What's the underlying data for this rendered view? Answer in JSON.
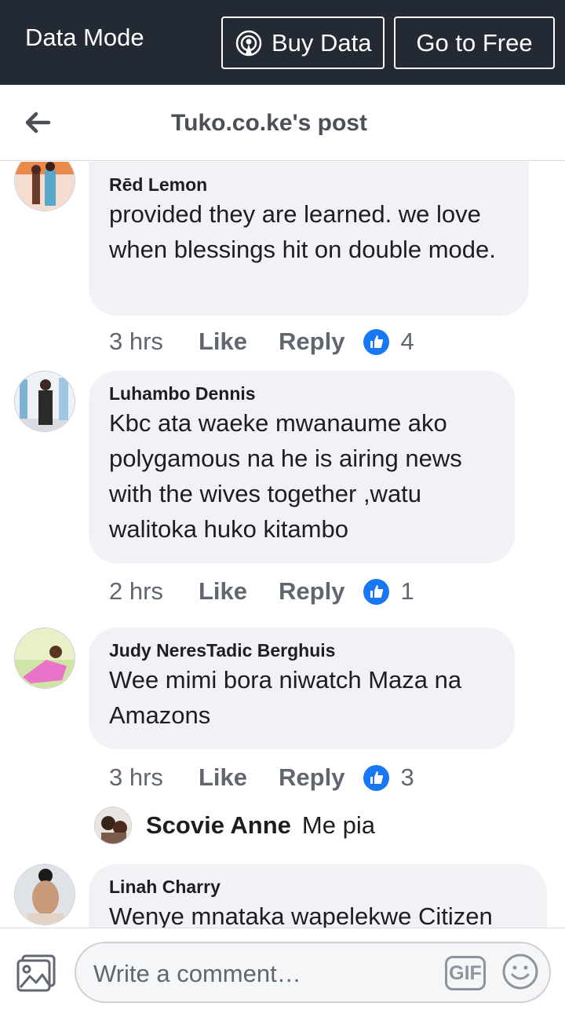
{
  "data_bar": {
    "mode_label": "Data Mode",
    "buy_label": "Buy Data",
    "free_label": "Go to Free"
  },
  "header": {
    "title": "Tuko.co.ke's post"
  },
  "comments": [
    {
      "author": "Rēd Lemon",
      "text": "provided they are learned. we love when blessings hit on double mode.",
      "time": "3 hrs",
      "like_label": "Like",
      "reply_label": "Reply",
      "likes": "4"
    },
    {
      "author": "Luhambo Dennis",
      "text": "Kbc ata waeke mwanaume ako polygamous na he is airing news with the wives together ,watu walitoka huko kitambo",
      "time": "2 hrs",
      "like_label": "Like",
      "reply_label": "Reply",
      "likes": "1"
    },
    {
      "author": "Judy NeresTadic Berghuis",
      "text": "Wee mimi bora niwatch Maza na Amazons",
      "time": "3 hrs",
      "like_label": "Like",
      "reply_label": "Reply",
      "likes": "3",
      "reply": {
        "author": "Scovie Anne",
        "text": "Me pia"
      }
    },
    {
      "author": "Linah Charry",
      "text": "Wenye mnataka wapelekwe Citizen"
    }
  ],
  "compose": {
    "placeholder": "Write a comment…",
    "gif_label": "GIF"
  },
  "colors": {
    "top_bar": "#242a33",
    "like_blue": "#1877f2",
    "bubble": "#f0f2f5"
  },
  "icons": [
    "broadcast-icon",
    "back-arrow-icon",
    "thumbs-up-icon",
    "photo-icon",
    "gif-icon",
    "emoji-icon"
  ]
}
